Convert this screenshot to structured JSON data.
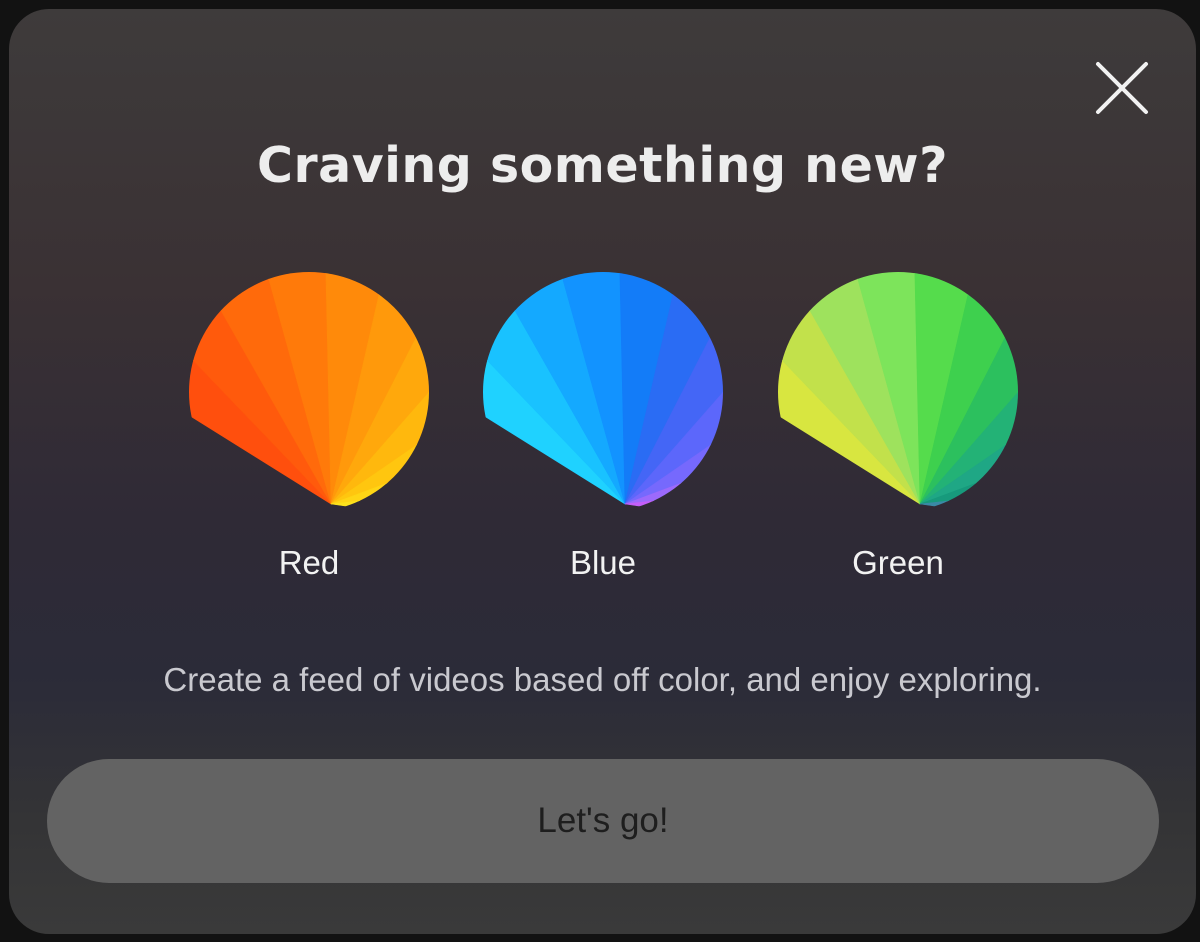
{
  "dialog": {
    "title": "Craving something new?",
    "close_icon": "close-icon",
    "description": "Create a feed of videos based off color, and enjoy exploring.",
    "cta_label": "Let's go!"
  },
  "options": [
    {
      "label": "Red",
      "icon": "red-color-wheel-icon",
      "colors": [
        "#ff4f0d",
        "#ff5a0c",
        "#ff6a0b",
        "#ff7a0a",
        "#ff8a0a",
        "#ff990b",
        "#ffa80c",
        "#ffb80d",
        "#ffc60f",
        "#ffd515",
        "#fde21d"
      ]
    },
    {
      "label": "Blue",
      "icon": "blue-color-wheel-icon",
      "colors": [
        "#1fd2ff",
        "#19c2ff",
        "#14a9ff",
        "#1293ff",
        "#137cf8",
        "#2a6cf4",
        "#4466f6",
        "#5c67fb",
        "#7669fd",
        "#9c6afc",
        "#c45ffa"
      ]
    },
    {
      "label": "Green",
      "icon": "green-color-wheel-icon",
      "colors": [
        "#d8e640",
        "#c2e14b",
        "#9ee25d",
        "#7de45b",
        "#55dc4c",
        "#3ed04e",
        "#2cc05e",
        "#23b276",
        "#1fa785",
        "#179a7c",
        "#3a8aa6"
      ]
    }
  ]
}
